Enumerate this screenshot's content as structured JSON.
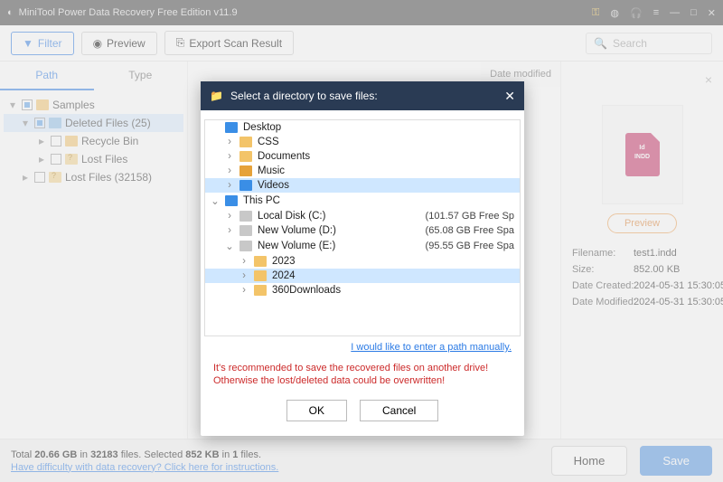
{
  "titlebar": {
    "title": "MiniTool Power Data Recovery Free Edition v11.9"
  },
  "toolbar": {
    "filter": "Filter",
    "preview": "Preview",
    "export": "Export Scan Result",
    "search_placeholder": "Search"
  },
  "tabs": {
    "path": "Path",
    "type": "Type"
  },
  "tree": {
    "samples": "Samples",
    "deleted": "Deleted Files (25)",
    "recycle": "Recycle Bin",
    "lost1": "Lost Files",
    "lost2": "Lost Files (32158)"
  },
  "list_header": {
    "modified": "Date modified"
  },
  "details": {
    "preview": "Preview",
    "k_filename": "Filename:",
    "v_filename": "test1.indd",
    "k_size": "Size:",
    "v_size": "852.00 KB",
    "k_created": "Date Created:",
    "v_created": "2024-05-31 15:30:05",
    "k_modified": "Date Modified:",
    "v_modified": "2024-05-31 15:30:05"
  },
  "footer": {
    "line1a": "Total ",
    "line1b": "20.66 GB",
    "line1c": " in ",
    "line1d": "32183",
    "line1e": " files.   Selected ",
    "line1f": "852 KB",
    "line1g": " in ",
    "line1h": "1",
    "line1i": " files.",
    "help": "Have difficulty with data recovery? Click here for instructions.",
    "home": "Home",
    "save": "Save"
  },
  "dialog": {
    "title": "Select a directory to save files:",
    "items": {
      "desktop": "Desktop",
      "css": "CSS",
      "documents": "Documents",
      "music": "Music",
      "videos": "Videos",
      "thispc": "This PC",
      "c": "Local Disk (C:)",
      "c_free": "(101.57 GB Free Sp",
      "d": "New Volume (D:)",
      "d_free": "(65.08 GB Free Spa",
      "e": "New Volume (E:)",
      "e_free": "(95.55 GB Free Spa",
      "y2023": "2023",
      "y2024": "2024",
      "dl": "360Downloads"
    },
    "manual": "I would like to enter a path manually.",
    "warn": "It's recommended to save the recovered files on another drive! Otherwise the lost/deleted data could be overwritten!",
    "ok": "OK",
    "cancel": "Cancel"
  }
}
